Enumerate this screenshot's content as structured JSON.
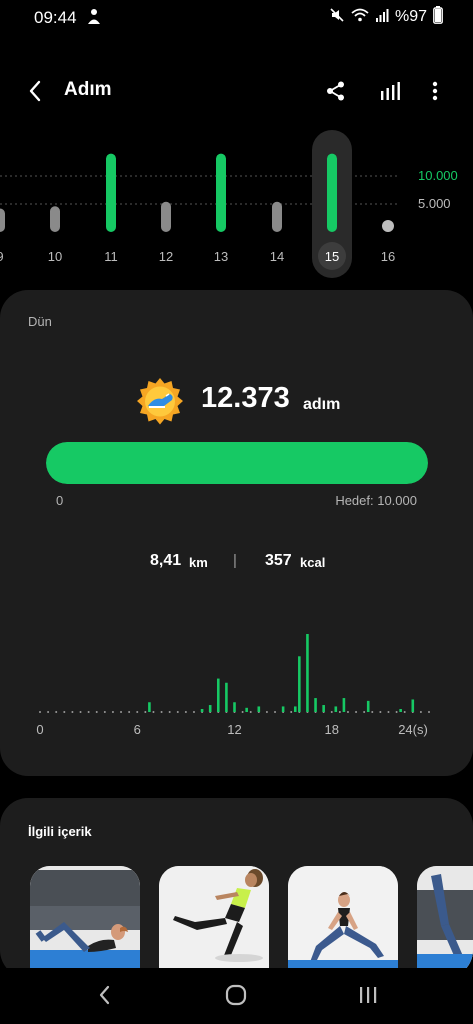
{
  "status_bar": {
    "time": "09:44",
    "battery": "%97"
  },
  "header": {
    "title": "Adım"
  },
  "day_chart": {
    "ticks": [
      "9",
      "10",
      "11",
      "12",
      "13",
      "14",
      "15",
      "16"
    ],
    "selected": "15",
    "gridline_labels": [
      "10.000",
      "5.000"
    ],
    "goal": 10000,
    "values": [
      4200,
      4600,
      14000,
      5400,
      14000,
      5400,
      14000,
      0
    ]
  },
  "summary": {
    "period_label": "Dün",
    "steps": "12.373",
    "steps_unit": "adım",
    "progress_fraction": 1.0,
    "progress_min": "0",
    "progress_goal": "Hedef: 10.000",
    "distance": "8,41",
    "distance_unit": "km",
    "separator": "|",
    "calories": "357",
    "calories_unit": "kcal"
  },
  "hourly_chart": {
    "x_labels": [
      "0",
      "6",
      "12",
      "18",
      "24(s)"
    ],
    "x_positions": [
      0,
      6,
      12,
      18,
      24
    ],
    "bars": [
      {
        "hour": 6.75,
        "value": 7
      },
      {
        "hour": 10.0,
        "value": 2
      },
      {
        "hour": 10.5,
        "value": 5
      },
      {
        "hour": 11.0,
        "value": 24
      },
      {
        "hour": 11.5,
        "value": 21
      },
      {
        "hour": 12.0,
        "value": 7
      },
      {
        "hour": 12.75,
        "value": 3
      },
      {
        "hour": 13.5,
        "value": 4
      },
      {
        "hour": 15.0,
        "value": 4
      },
      {
        "hour": 15.75,
        "value": 4
      },
      {
        "hour": 16.0,
        "value": 40
      },
      {
        "hour": 16.5,
        "value": 56
      },
      {
        "hour": 17.0,
        "value": 10
      },
      {
        "hour": 17.5,
        "value": 5
      },
      {
        "hour": 18.25,
        "value": 4
      },
      {
        "hour": 18.75,
        "value": 10
      },
      {
        "hour": 20.25,
        "value": 8
      },
      {
        "hour": 22.25,
        "value": 2
      },
      {
        "hour": 23.0,
        "value": 9
      }
    ]
  },
  "related": {
    "title": "İlgili içerik"
  },
  "colors": {
    "accent": "#16c964",
    "inactive_bar": "#8a8a8a",
    "card": "#1d1d1d",
    "background": "#000000"
  }
}
